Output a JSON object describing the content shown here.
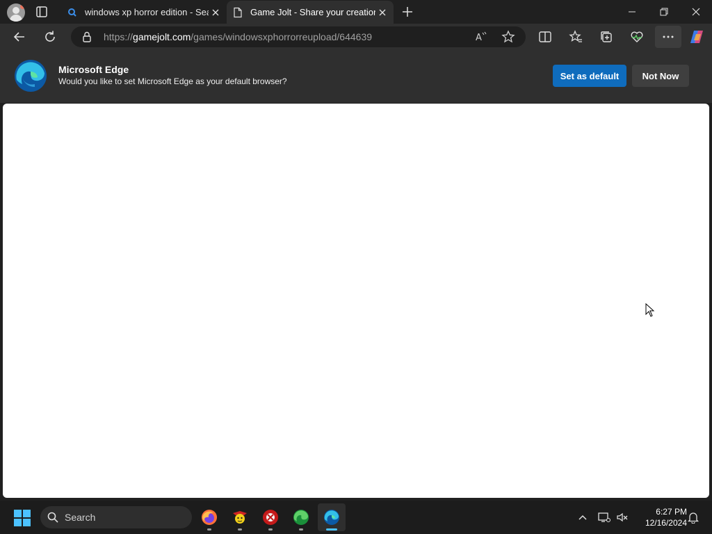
{
  "browser": {
    "tabs": [
      {
        "title": "windows xp horror edition - Search",
        "active": false,
        "icon": "search-icon"
      },
      {
        "title": "Game Jolt - Share your creations",
        "active": true,
        "icon": "page-icon"
      }
    ],
    "address_bar": {
      "url_prefix": "https://",
      "url_domain": "gamejolt.com",
      "url_path": "/games/windowsxphorrorreupload/644639"
    }
  },
  "infobar": {
    "title": "Microsoft Edge",
    "message": "Would you like to set Microsoft Edge as your default browser?",
    "primary_button": "Set as default",
    "secondary_button": "Not Now"
  },
  "taskbar": {
    "search_placeholder": "Search",
    "apps": [
      "firefox-icon",
      "bonzi-icon",
      "malware-app-icon",
      "edge-green-icon",
      "edge-icon"
    ],
    "time": "6:27 PM",
    "date": "12/16/2024"
  },
  "colors": {
    "accent": "#0f6cbd",
    "titlebar": "#202020",
    "toolbar": "#2f2f2f",
    "taskbar": "#1c1c1c",
    "active_indicator": "#4cc2ff"
  }
}
